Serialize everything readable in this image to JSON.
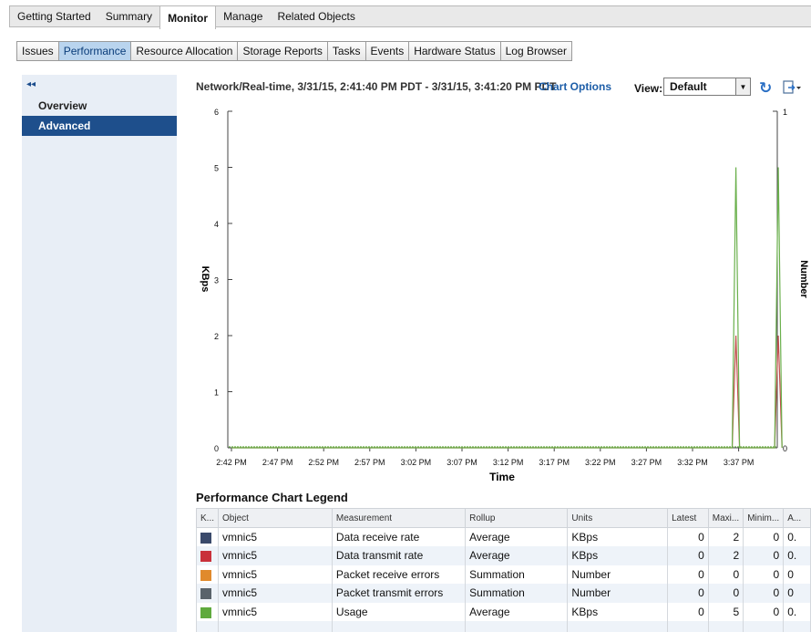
{
  "top_tabs": [
    "Getting Started",
    "Summary",
    "Monitor",
    "Manage",
    "Related Objects"
  ],
  "active_top_tab": "Monitor",
  "sub_tabs": [
    "Issues",
    "Performance",
    "Resource Allocation",
    "Storage Reports",
    "Tasks",
    "Events",
    "Hardware Status",
    "Log Browser"
  ],
  "active_sub_tab": "Performance",
  "left_nav": {
    "collapse_icon": "double-chevron-left-icon",
    "items": [
      "Overview",
      "Advanced"
    ],
    "selected": "Advanced"
  },
  "chart_header": {
    "title": "Network/Real-time, 3/31/15, 2:41:40 PM PDT - 3/31/15, 3:41:20 PM PDT",
    "chart_options_link": "Chart Options",
    "view_label": "View:",
    "view_value": "Default",
    "refresh_icon": "refresh-icon",
    "export_icon": "export-icon"
  },
  "chart_data": {
    "type": "line",
    "xlabel": "Time",
    "ylabel": "KBps",
    "y2label": "Number",
    "ylim": [
      0,
      6
    ],
    "y2lim": [
      0,
      1
    ],
    "yticks": [
      "0",
      "1",
      "2",
      "3",
      "4",
      "5",
      "6"
    ],
    "y2ticks": [
      "0",
      "1"
    ],
    "x_tick_labels": [
      "2:42 PM",
      "2:47 PM",
      "2:52 PM",
      "2:57 PM",
      "3:02 PM",
      "3:07 PM",
      "3:12 PM",
      "3:17 PM",
      "3:22 PM",
      "3:27 PM",
      "3:32 PM",
      "3:37 PM"
    ],
    "x_minutes": [
      0,
      5,
      10,
      15,
      20,
      25,
      30,
      35,
      40,
      45,
      50,
      55
    ],
    "x_range_minutes": [
      0,
      59.7
    ],
    "series": [
      {
        "name": "Data receive rate",
        "color": "#c0504d",
        "x_minutes": [
          0,
          54.3,
          54.7,
          55.1,
          58.9,
          59.3,
          59.7
        ],
        "values": [
          0,
          0,
          2,
          0,
          0,
          2,
          0
        ]
      },
      {
        "name": "Usage",
        "color": "#6ab04c",
        "x_minutes": [
          0,
          54.3,
          54.7,
          55.1,
          58.9,
          59.3,
          59.7
        ],
        "values": [
          0,
          0,
          5,
          0,
          0,
          5,
          0
        ]
      }
    ]
  },
  "legend": {
    "title": "Performance Chart Legend",
    "columns": [
      "K...",
      "Object",
      "Measurement",
      "Rollup",
      "Units",
      "Latest",
      "Maxi...",
      "Minim...",
      "A..."
    ],
    "rows": [
      {
        "color": "#3a4a6b",
        "object": "vmnic5",
        "measurement": "Data receive rate",
        "rollup": "Average",
        "units": "KBps",
        "latest": "0",
        "max": "2",
        "min": "0",
        "avg": "0."
      },
      {
        "color": "#c9303a",
        "object": "vmnic5",
        "measurement": "Data transmit rate",
        "rollup": "Average",
        "units": "KBps",
        "latest": "0",
        "max": "2",
        "min": "0",
        "avg": "0."
      },
      {
        "color": "#e08a2c",
        "object": "vmnic5",
        "measurement": "Packet receive errors",
        "rollup": "Summation",
        "units": "Number",
        "latest": "0",
        "max": "0",
        "min": "0",
        "avg": "0"
      },
      {
        "color": "#5a636b",
        "object": "vmnic5",
        "measurement": "Packet transmit errors",
        "rollup": "Summation",
        "units": "Number",
        "latest": "0",
        "max": "0",
        "min": "0",
        "avg": "0"
      },
      {
        "color": "#5faa3e",
        "object": "vmnic5",
        "measurement": "Usage",
        "rollup": "Average",
        "units": "KBps",
        "latest": "0",
        "max": "5",
        "min": "0",
        "avg": "0."
      }
    ]
  }
}
